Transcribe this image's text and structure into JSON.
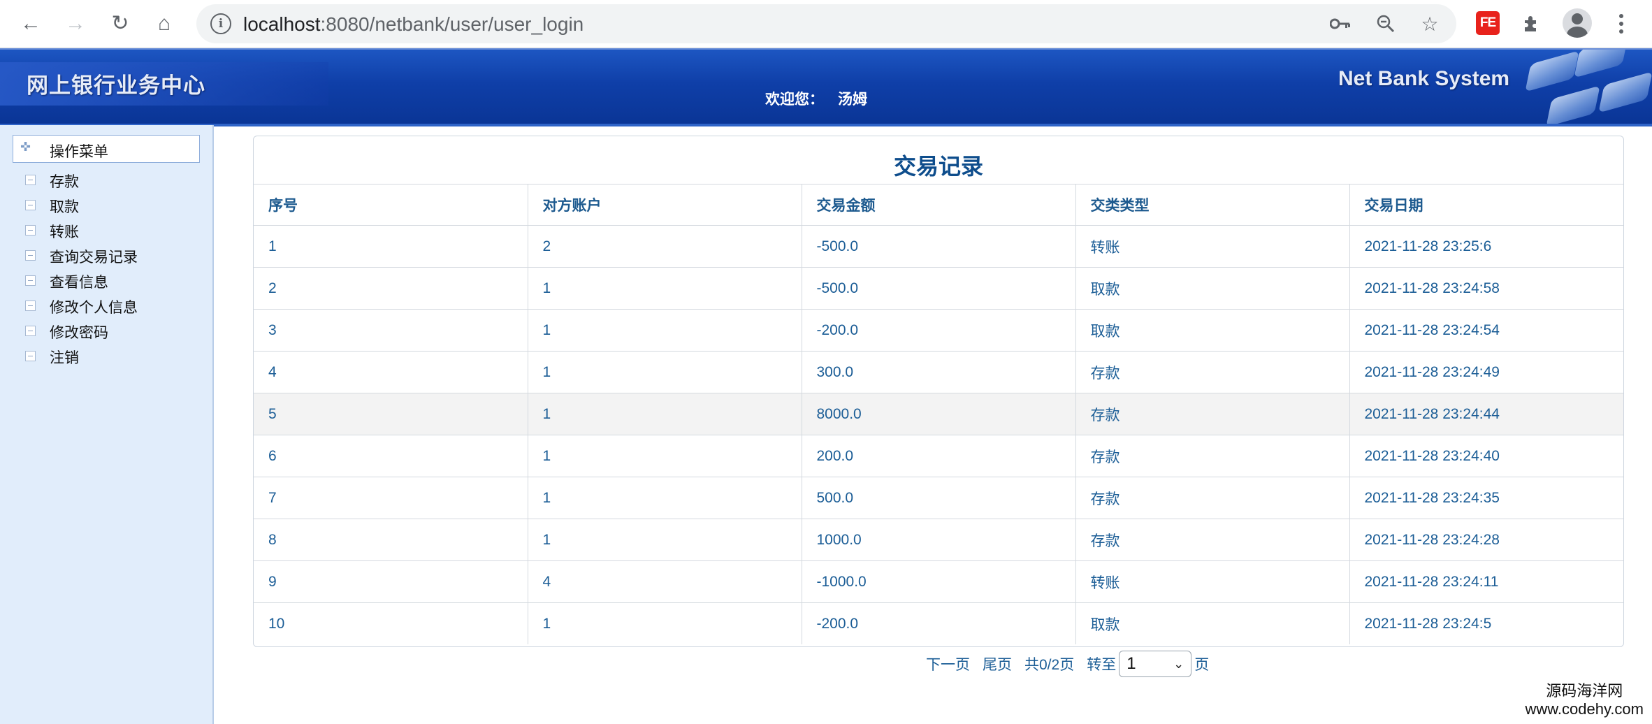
{
  "browser": {
    "url_host": "localhost",
    "url_rest": ":8080/netbank/user/user_login",
    "extension_label": "FE"
  },
  "banner": {
    "title": "网上银行业务中心",
    "welcome_label": "欢迎您：",
    "username": "汤姆",
    "system_name": "Net Bank System"
  },
  "sidebar": {
    "header": "操作菜单",
    "items": [
      {
        "label": "存款"
      },
      {
        "label": "取款"
      },
      {
        "label": "转账"
      },
      {
        "label": "查询交易记录"
      },
      {
        "label": "查看信息"
      },
      {
        "label": "修改个人信息"
      },
      {
        "label": "修改密码"
      },
      {
        "label": "注销"
      }
    ]
  },
  "records": {
    "title": "交易记录",
    "columns": [
      "序号",
      "对方账户",
      "交易金额",
      "交类类型",
      "交易日期"
    ],
    "rows": [
      [
        "1",
        "2",
        "-500.0",
        "转账",
        "2021-11-28 23:25:6"
      ],
      [
        "2",
        "1",
        "-500.0",
        "取款",
        "2021-11-28 23:24:58"
      ],
      [
        "3",
        "1",
        "-200.0",
        "取款",
        "2021-11-28 23:24:54"
      ],
      [
        "4",
        "1",
        "300.0",
        "存款",
        "2021-11-28 23:24:49"
      ],
      [
        "5",
        "1",
        "8000.0",
        "存款",
        "2021-11-28 23:24:44"
      ],
      [
        "6",
        "1",
        "200.0",
        "存款",
        "2021-11-28 23:24:40"
      ],
      [
        "7",
        "1",
        "500.0",
        "存款",
        "2021-11-28 23:24:35"
      ],
      [
        "8",
        "1",
        "1000.0",
        "存款",
        "2021-11-28 23:24:28"
      ],
      [
        "9",
        "4",
        "-1000.0",
        "转账",
        "2021-11-28 23:24:11"
      ],
      [
        "10",
        "1",
        "-200.0",
        "取款",
        "2021-11-28 23:24:5"
      ]
    ],
    "highlighted_row": 4
  },
  "pager": {
    "next": "下一页",
    "last": "尾页",
    "total": "共0/2页",
    "goto": "转至",
    "page_value": "1",
    "page_suffix": "页"
  },
  "watermark": {
    "line1": "源码海洋网",
    "line2": "www.codehy.com"
  }
}
